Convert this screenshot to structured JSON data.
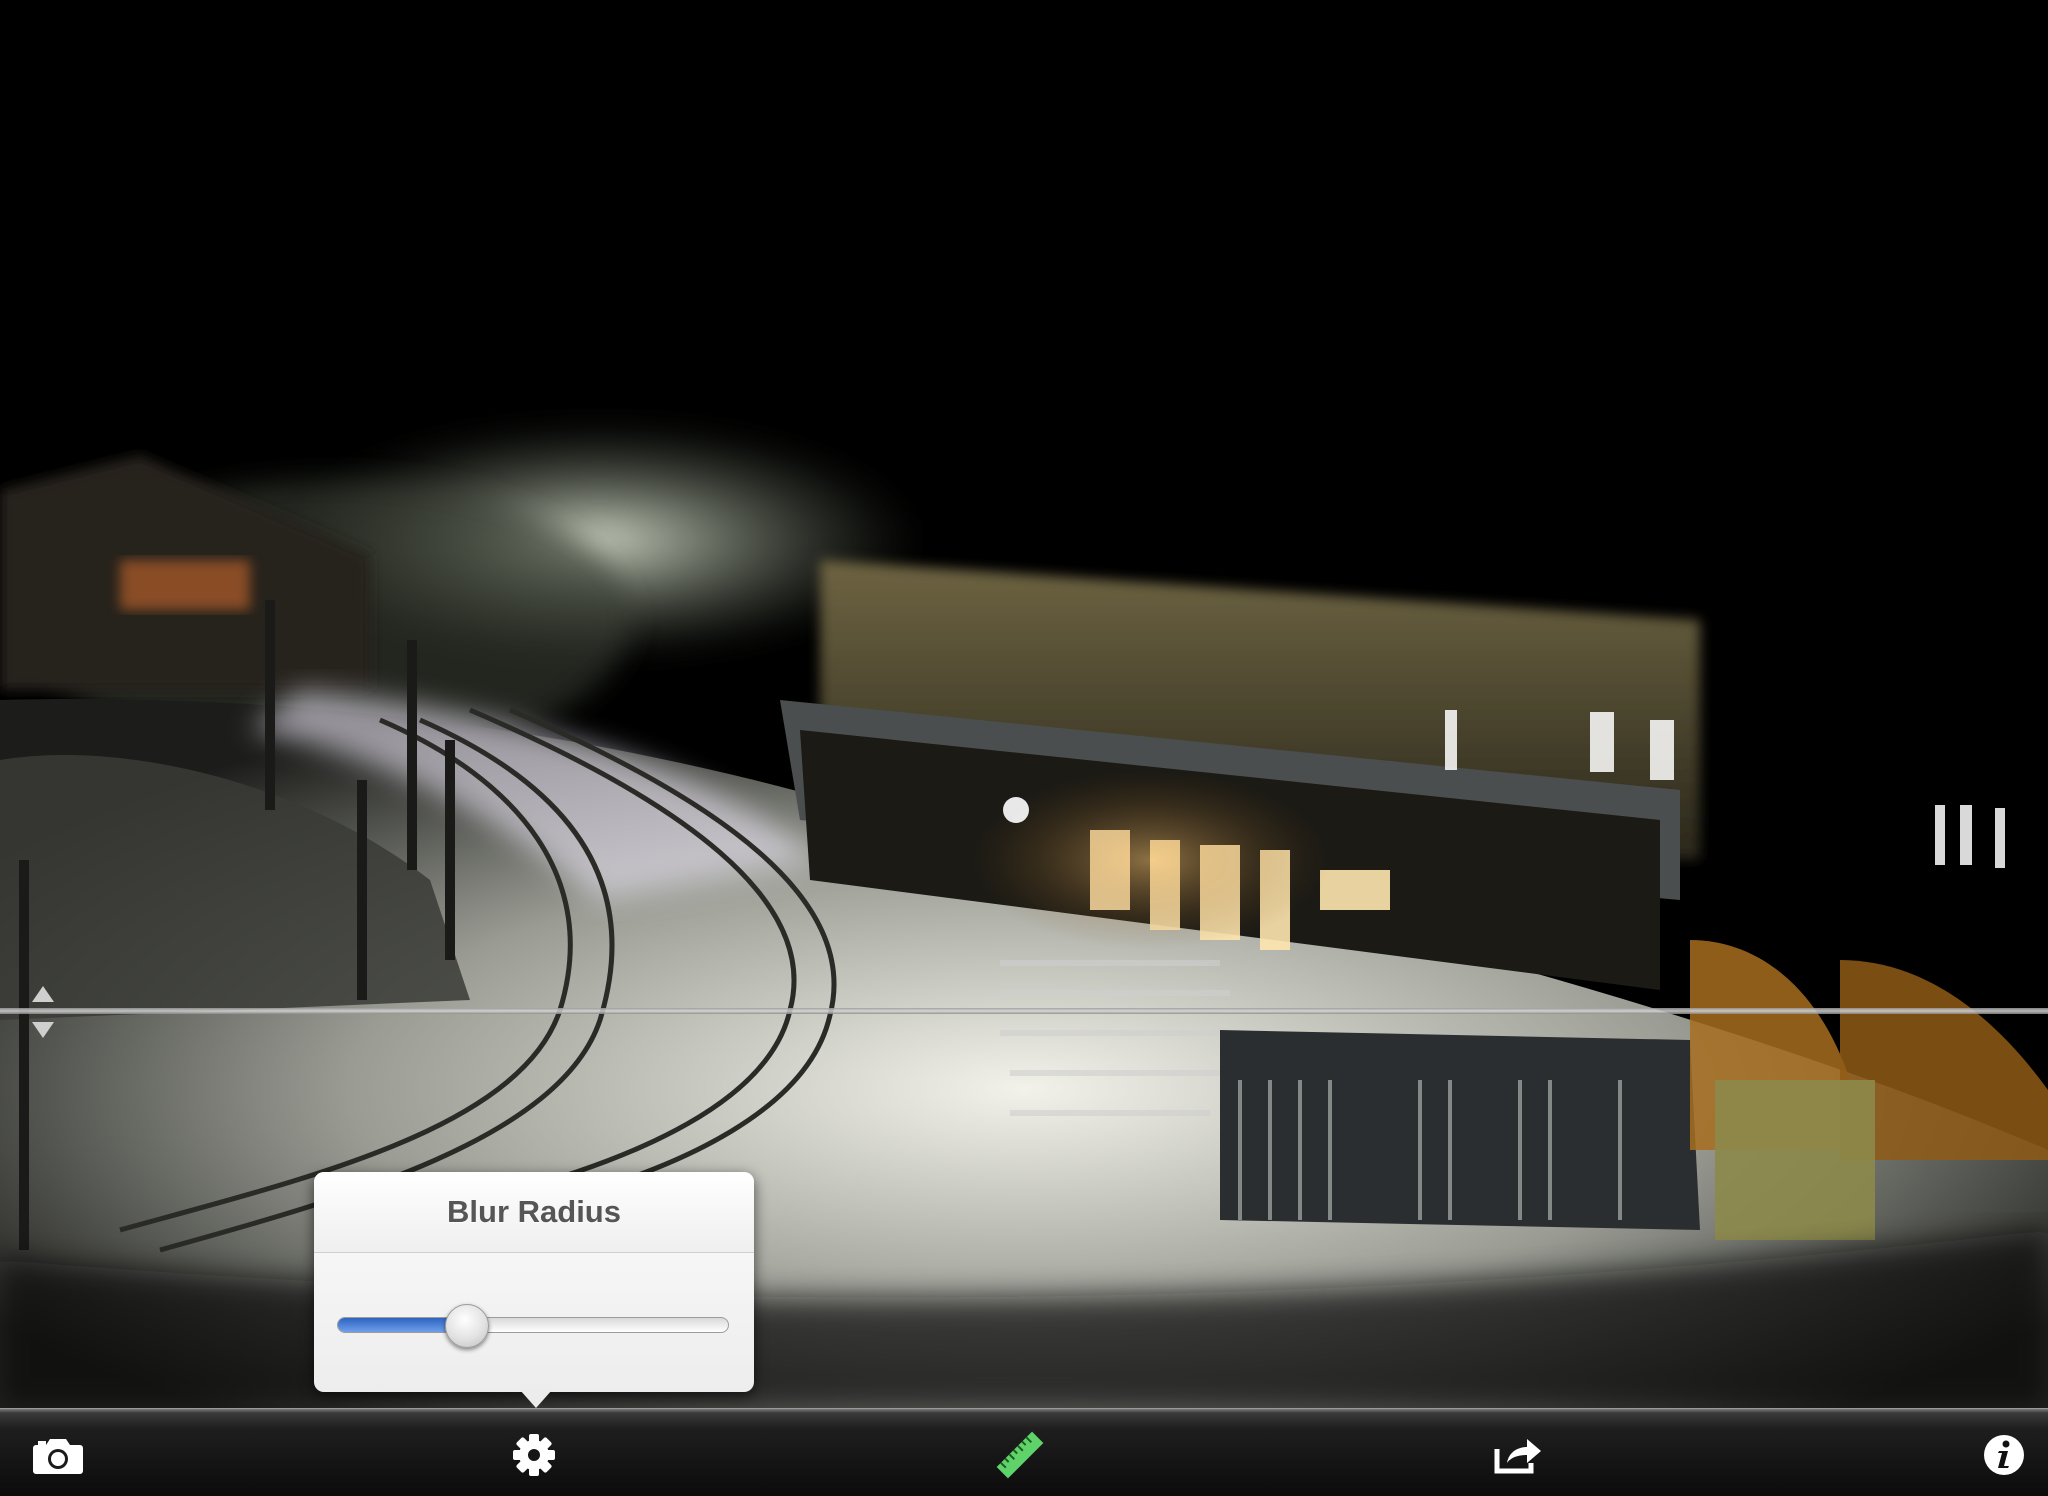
{
  "popover": {
    "title": "Blur Radius",
    "slider_value": 0.33
  },
  "toolbar": {
    "buttons": [
      {
        "name": "camera-icon"
      },
      {
        "name": "gear-icon"
      },
      {
        "name": "ruler-icon",
        "color": "#5fd36a"
      },
      {
        "name": "share-icon"
      },
      {
        "name": "info-icon"
      }
    ]
  },
  "colors": {
    "slider_fill": "#3a72d6",
    "toolbar_bg": "#1a1a1a",
    "popover_bg": "#f4f4f4"
  }
}
